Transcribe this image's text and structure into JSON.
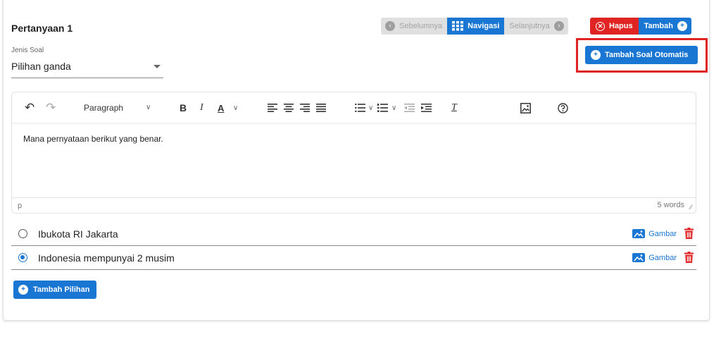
{
  "question": {
    "title": "Pertanyaan 1"
  },
  "navigation": {
    "prev_label": "Sebelumnya",
    "nav_label": "Navigasi",
    "next_label": "Selanjutnya"
  },
  "actions": {
    "delete_label": "Hapus",
    "add_label": "Tambah",
    "auto_add_label": "Tambah Soal Otomatis"
  },
  "question_type": {
    "label": "Jenis Soal",
    "value": "Pilihan ganda"
  },
  "editor": {
    "block_format": "Paragraph",
    "content": "Mana pernyataan berikut yang benar.",
    "status_path": "p",
    "word_count": "5 words"
  },
  "choices": [
    {
      "text": "Ibukota RI Jakarta",
      "selected": false,
      "image_label": "Gambar"
    },
    {
      "text": "Indonesia mempunyai 2 musim",
      "selected": true,
      "image_label": "Gambar"
    }
  ],
  "add_choice_label": "Tambah Pilihan",
  "colors": {
    "primary": "#1976d2",
    "danger": "#e02424",
    "disabled": "#e0e0e0"
  }
}
